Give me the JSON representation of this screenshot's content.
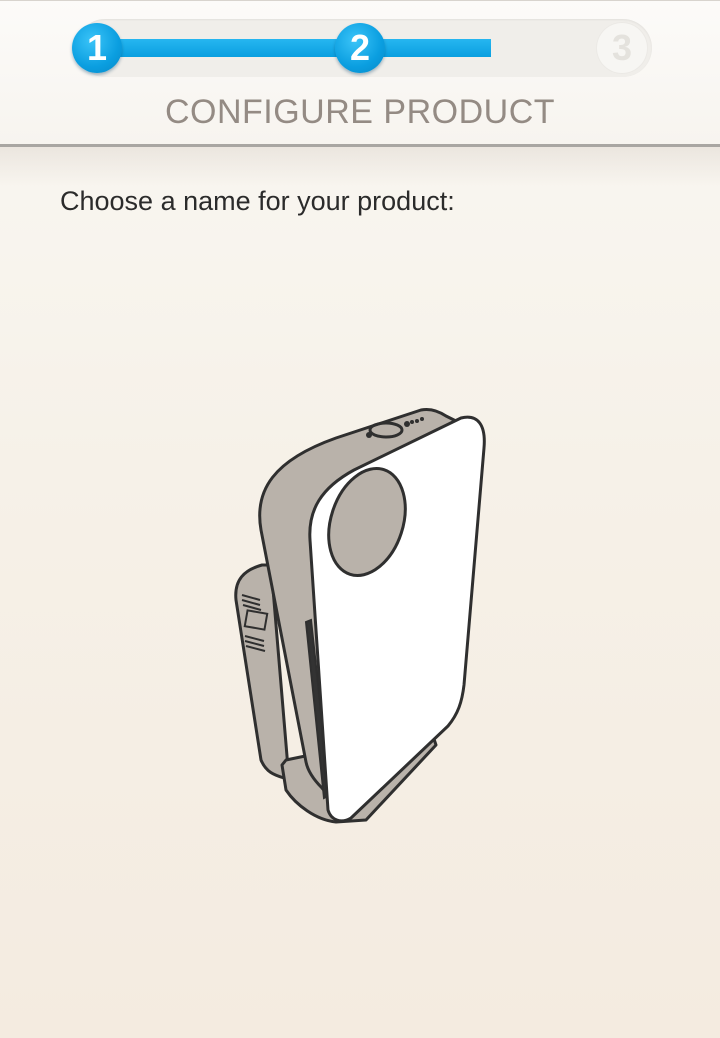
{
  "steps": [
    {
      "label": "1",
      "state": "complete"
    },
    {
      "label": "2",
      "state": "current"
    },
    {
      "label": "3",
      "state": "pending"
    }
  ],
  "progress": {
    "value_percent": 72,
    "color": "#0aa0e2"
  },
  "header": {
    "title": "CONFIGURE PRODUCT"
  },
  "main": {
    "prompt": "Choose a name for your product:",
    "illustration": "air-purifier-product-illustration"
  }
}
